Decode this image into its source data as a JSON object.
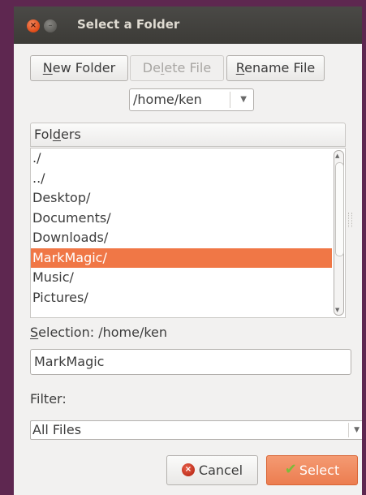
{
  "window": {
    "title": "Select a Folder",
    "close_glyph": "×",
    "minimize_glyph": "–"
  },
  "toolbar": {
    "new_folder": {
      "pre": "",
      "mnemonic": "N",
      "post": "ew Folder"
    },
    "delete_file": {
      "pre": "De",
      "mnemonic": "l",
      "post": "ete File"
    },
    "rename_file": {
      "pre": "",
      "mnemonic": "R",
      "post": "ename File"
    }
  },
  "path_combo": {
    "value": "/home/ken",
    "arrow_icon": "chevron-down-icon",
    "arrow_glyph": "▼"
  },
  "folders": {
    "header": {
      "pre": "Fol",
      "mnemonic": "d",
      "post": "ers"
    },
    "items": [
      {
        "label": "./",
        "selected": false
      },
      {
        "label": "../",
        "selected": false
      },
      {
        "label": "Desktop/",
        "selected": false
      },
      {
        "label": "Documents/",
        "selected": false
      },
      {
        "label": "Downloads/",
        "selected": false
      },
      {
        "label": "MarkMagic/",
        "selected": true
      },
      {
        "label": "Music/",
        "selected": false
      },
      {
        "label": "Pictures/",
        "selected": false
      }
    ],
    "scroll_up_glyph": "▲",
    "scroll_down_glyph": "▼"
  },
  "selection": {
    "label": {
      "pre": "",
      "mnemonic": "S",
      "post": "election: /home/ken"
    },
    "value": "MarkMagic"
  },
  "filter": {
    "label": "Filter:",
    "value": "All Files",
    "arrow_glyph": "▼"
  },
  "actions": {
    "cancel_label": "Cancel",
    "cancel_icon": "cancel-icon",
    "cancel_icon_glyph": "×",
    "select_label": "Select",
    "select_icon": "check-icon",
    "select_icon_glyph": "✔"
  },
  "colors": {
    "title_bar": "#3c3b37",
    "accent": "#f07746",
    "window_bg": "#f2f1f0",
    "desktop_bg": "#5e2750"
  }
}
